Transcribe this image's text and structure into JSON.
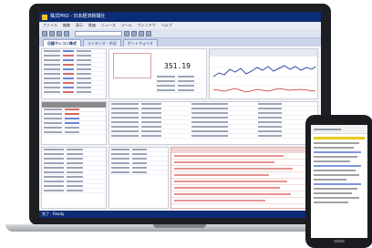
{
  "window": {
    "title": "株式PRO - 日本経済新聞社"
  },
  "menu": {
    "items": [
      "ファイル",
      "編集",
      "表示",
      "株価",
      "ニュース",
      "ツール",
      "ウィンドウ",
      "ヘルプ"
    ]
  },
  "tabs": [
    {
      "label": "日経テレコン株式"
    },
    {
      "label": "ランキング・市況"
    },
    {
      "label": "ポートフォリオ"
    }
  ],
  "quote": {
    "price": "351.19"
  },
  "status": {
    "text": "完了 - Ready"
  },
  "colors": {
    "titlebar": "#0c2c73",
    "news_text": "#d23a3a",
    "chart_line": "#3a4fa0"
  }
}
